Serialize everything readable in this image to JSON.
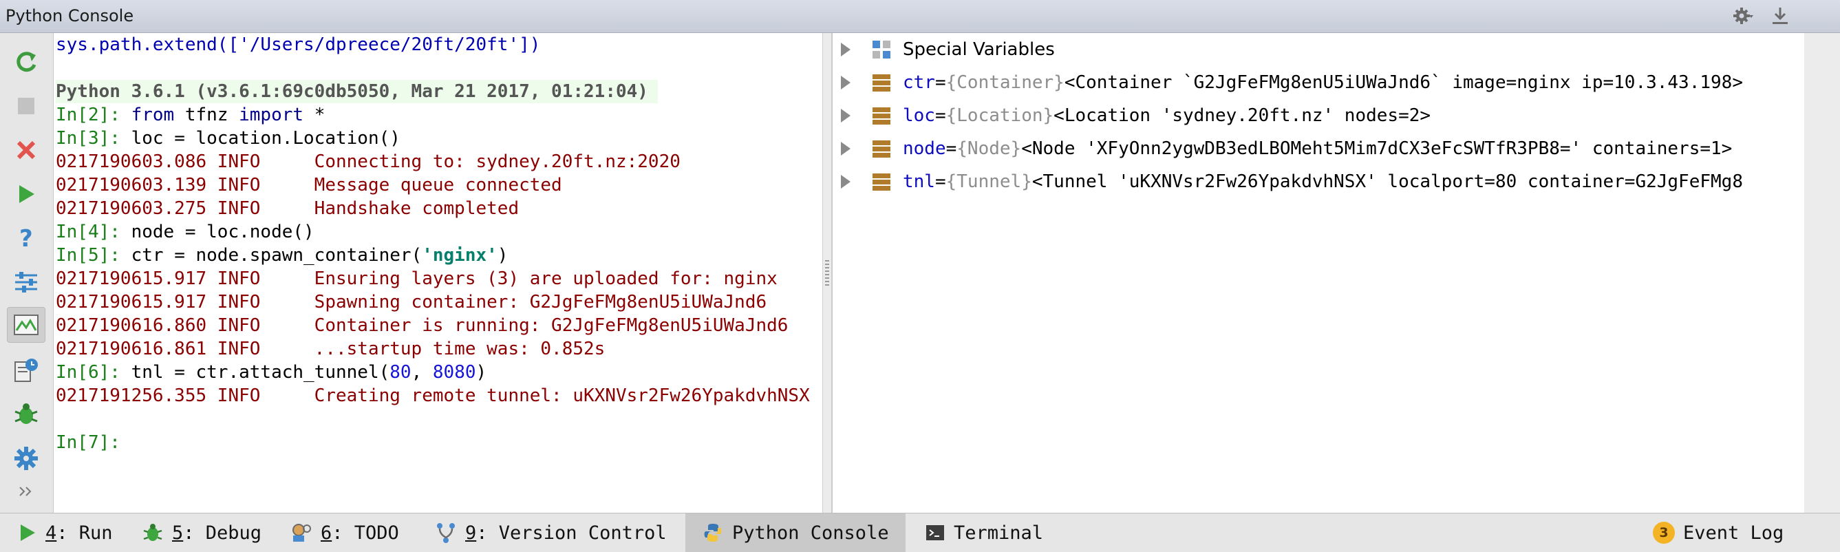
{
  "window": {
    "title": "Python Console"
  },
  "colors": {
    "prompt": "#1a7f1a",
    "log": "#8b0000",
    "keyword": "#00008b",
    "string": "#06806b",
    "number": "#1515d8",
    "highlight": "#edfceb"
  },
  "console": {
    "lines": [
      "sys.path.extend(['/Users/dpreece/20ft/20ft'])",
      "",
      "Python 3.6.1 (v3.6.1:69c0db5050, Mar 21 2017, 01:21:04)",
      "In[2]: from tfnz import *",
      "In[3]: loc = location.Location()",
      "0217190603.086 INFO     Connecting to: sydney.20ft.nz:2020",
      "0217190603.139 INFO     Message queue connected",
      "0217190603.275 INFO     Handshake completed",
      "In[4]: node = loc.node()",
      "In[5]: ctr = node.spawn_container('nginx')",
      "0217190615.917 INFO     Ensuring layers (3) are uploaded for: nginx",
      "0217190615.917 INFO     Spawning container: G2JgFeFMg8enU5iUWaJnd6",
      "0217190616.860 INFO     Container is running: G2JgFeFMg8enU5iUWaJnd6",
      "0217190616.861 INFO     ...startup time was: 0.852s",
      "In[6]: tnl = ctr.attach_tunnel(80, 8080)",
      "0217191256.355 INFO     Creating remote tunnel: uKXNVsr2Fw26YpakdvhNSX",
      "",
      "In[7]: "
    ],
    "parts": {
      "l0": "sys.path.extend(['/Users/dpreece/20ft/20ft'])",
      "l2": "Python 3.6.1 (v3.6.1:69c0db5050, Mar 21 2017, 01:21:04)",
      "in2": "In[2]: ",
      "from": "from",
      "tfnz": " tfnz ",
      "import": "import",
      "star": " *",
      "in3": "In[3]: ",
      "l4": "loc = location.Location()",
      "l5": "0217190603.086 INFO     Connecting to: sydney.20ft.nz:2020",
      "l6": "0217190603.139 INFO     Message queue connected",
      "l7": "0217190603.275 INFO     Handshake completed",
      "in4": "In[4]: ",
      "l8": "node = loc.node()",
      "in5": "In[5]: ",
      "l9a": "ctr = node.spawn_container(",
      "l9s": "'nginx'",
      "l9b": ")",
      "l10": "0217190615.917 INFO     Ensuring layers (3) are uploaded for: nginx",
      "l11": "0217190615.917 INFO     Spawning container: G2JgFeFMg8enU5iUWaJnd6",
      "l12": "0217190616.860 INFO     Container is running: G2JgFeFMg8enU5iUWaJnd6",
      "l13": "0217190616.861 INFO     ...startup time was: 0.852s",
      "in6": "In[6]: ",
      "l14a": "tnl = ctr.attach_tunnel(",
      "n80": "80",
      "comma": ", ",
      "n8080": "8080",
      "l14b": ")",
      "l15": "0217191256.355 INFO     Creating remote tunnel: uKXNVsr2Fw26YpakdvhNSX",
      "in7": "In[7]: "
    }
  },
  "variables": {
    "special": "Special Variables",
    "items": [
      {
        "name": "ctr",
        "eq": " = ",
        "type": "{Container}",
        "value": " <Container `G2JgFeFMg8enU5iUWaJnd6` image=nginx ip=10.3.43.198>"
      },
      {
        "name": "loc",
        "eq": " = ",
        "type": "{Location}",
        "value": " <Location 'sydney.20ft.nz' nodes=2>"
      },
      {
        "name": "node",
        "eq": " = ",
        "type": "{Node}",
        "value": " <Node 'XFyOnn2ygwDB3edLBOMeht5Mim7dCX3eFcSWTfR3PB8=' containers=1>"
      },
      {
        "name": "tnl",
        "eq": " = ",
        "type": "{Tunnel}",
        "value": " <Tunnel 'uKXNVsr2Fw26YpakdvhNSX' localport=80 container=G2JgFeFMg8"
      }
    ]
  },
  "bottom_tabs": {
    "run": {
      "num": "4",
      "label": ": Run"
    },
    "debug": {
      "num": "5",
      "label": ": Debug"
    },
    "todo": {
      "num": "6",
      "label": ": TODO"
    },
    "vcs": {
      "num": "9",
      "label": ": Version Control"
    },
    "console": {
      "label": "Python Console"
    },
    "terminal": {
      "label": "Terminal"
    },
    "eventlog": {
      "badge": "3",
      "label": "Event Log"
    }
  }
}
